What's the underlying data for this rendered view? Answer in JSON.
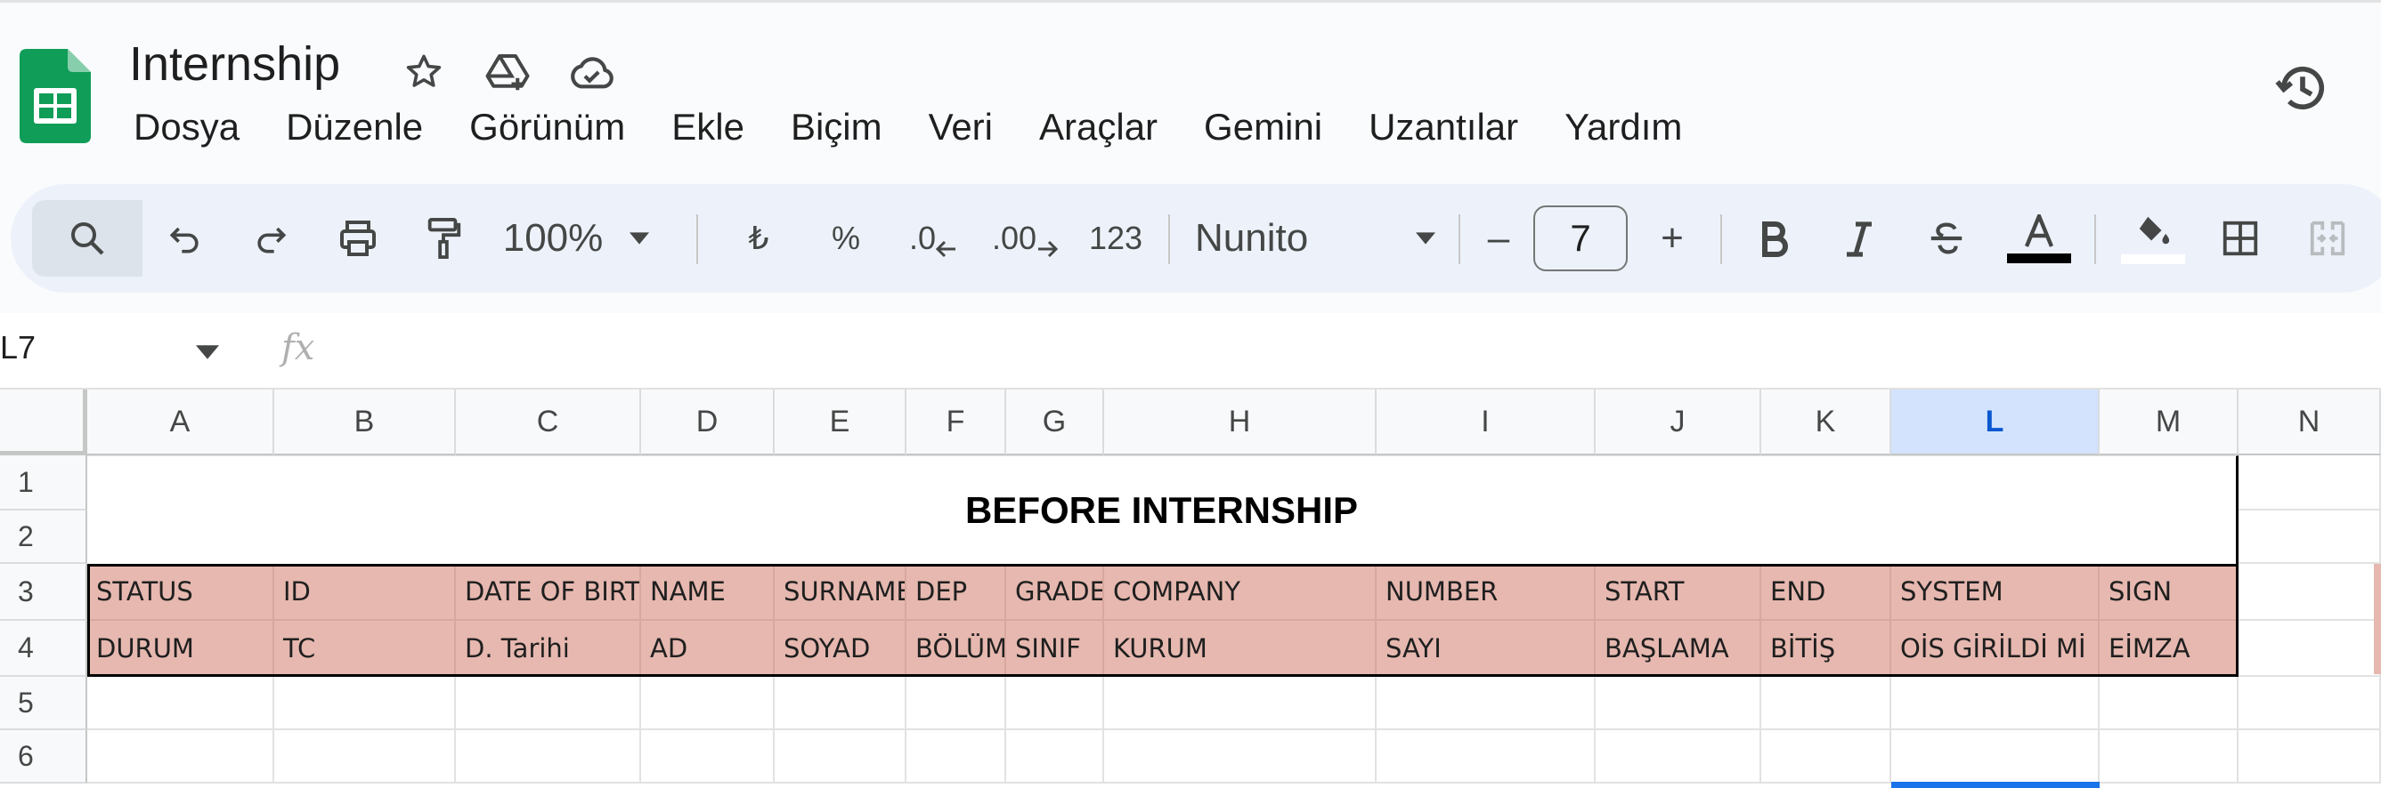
{
  "app": {
    "doc_title": "Internship",
    "title_icons": [
      "star-icon",
      "move-to-drive-icon",
      "cloud-saved-icon"
    ],
    "history_icon": "version-history-icon",
    "brand_color": "#0f9d58"
  },
  "menu": [
    "Dosya",
    "Düzenle",
    "Görünüm",
    "Ekle",
    "Biçim",
    "Veri",
    "Araçlar",
    "Gemini",
    "Uzantılar",
    "Yardım"
  ],
  "toolbar": {
    "zoom": "100%",
    "currency": "₺",
    "percent": "%",
    "dec_decrease": ".0",
    "dec_increase": ".00",
    "number_format": "123",
    "font": "Nunito",
    "font_size": "7",
    "minus": "–",
    "plus": "+"
  },
  "formula_bar": {
    "name_box": "L7",
    "fx": "fx",
    "value": ""
  },
  "columns": [
    "A",
    "B",
    "C",
    "D",
    "E",
    "F",
    "G",
    "H",
    "I",
    "J",
    "K",
    "L",
    "M",
    "N"
  ],
  "selected_column": "L",
  "rows": [
    "1",
    "2",
    "3",
    "4",
    "5",
    "6"
  ],
  "sheet": {
    "title": "BEFORE INTERNSHIP",
    "header_row_en": [
      "STATUS",
      "ID",
      "DATE OF BIRTH",
      "NAME",
      "SURNAME",
      "DEP",
      "GRADE",
      "COMPANY",
      "NUMBER",
      "START",
      "END",
      "SYSTEM",
      "SIGN"
    ],
    "header_row_tr": [
      "DURUM",
      "TC",
      "D. Tarihi",
      "AD",
      "SOYAD",
      "BÖLÜM",
      "SINIF",
      "KURUM",
      "SAYI",
      "BAŞLAMA",
      "BİTİŞ",
      "OİS GİRİLDİ Mİ",
      "EİMZA"
    ],
    "header_fill": "#e6b8af"
  }
}
